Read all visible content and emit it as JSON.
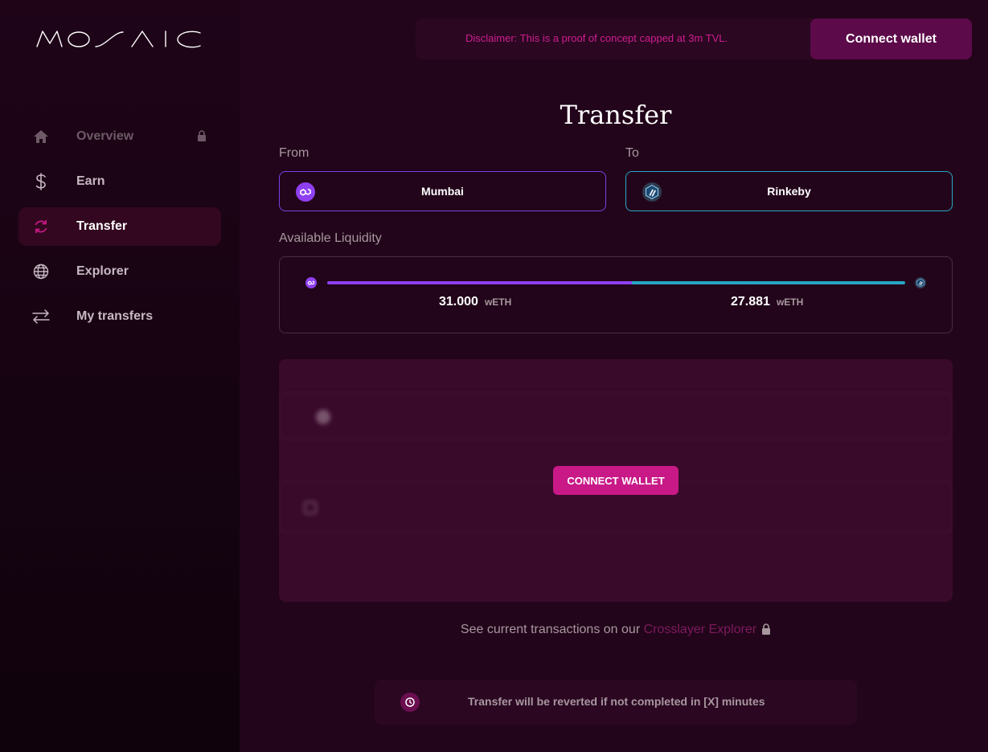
{
  "brand": {
    "logo_text": "MOSAIC"
  },
  "sidebar": {
    "items": [
      {
        "label": "Overview",
        "icon": "home-icon",
        "locked": true
      },
      {
        "label": "Earn",
        "icon": "dollar-icon"
      },
      {
        "label": "Transfer",
        "icon": "refresh-icon",
        "active": true
      },
      {
        "label": "Explorer",
        "icon": "globe-icon"
      },
      {
        "label": "My transfers",
        "icon": "arrows-swap-icon"
      }
    ]
  },
  "header": {
    "disclaimer": "Disclaimer: This is a proof of concept capped at 3m TVL.",
    "connect_label": "Connect wallet"
  },
  "main": {
    "title": "Transfer",
    "from_label": "From",
    "to_label": "To",
    "from_network": "Mumbai",
    "to_network": "Rinkeby",
    "liquidity_label": "Available Liquidity",
    "liquidity": {
      "from_value": "31.000",
      "from_unit": "wETH",
      "to_value": "27.881",
      "to_unit": "wETH"
    },
    "connect_label": "CONNECT WALLET",
    "explorer_note_prefix": "See current transactions on our ",
    "explorer_link": "Crosslayer Explorer",
    "revert_note": "Transfer will be reverted if not completed in [X] minutes"
  },
  "colors": {
    "accent": "#c81987",
    "from_network": "#8f3ff0",
    "to_network": "#26a6c4",
    "background": "#22051a"
  }
}
